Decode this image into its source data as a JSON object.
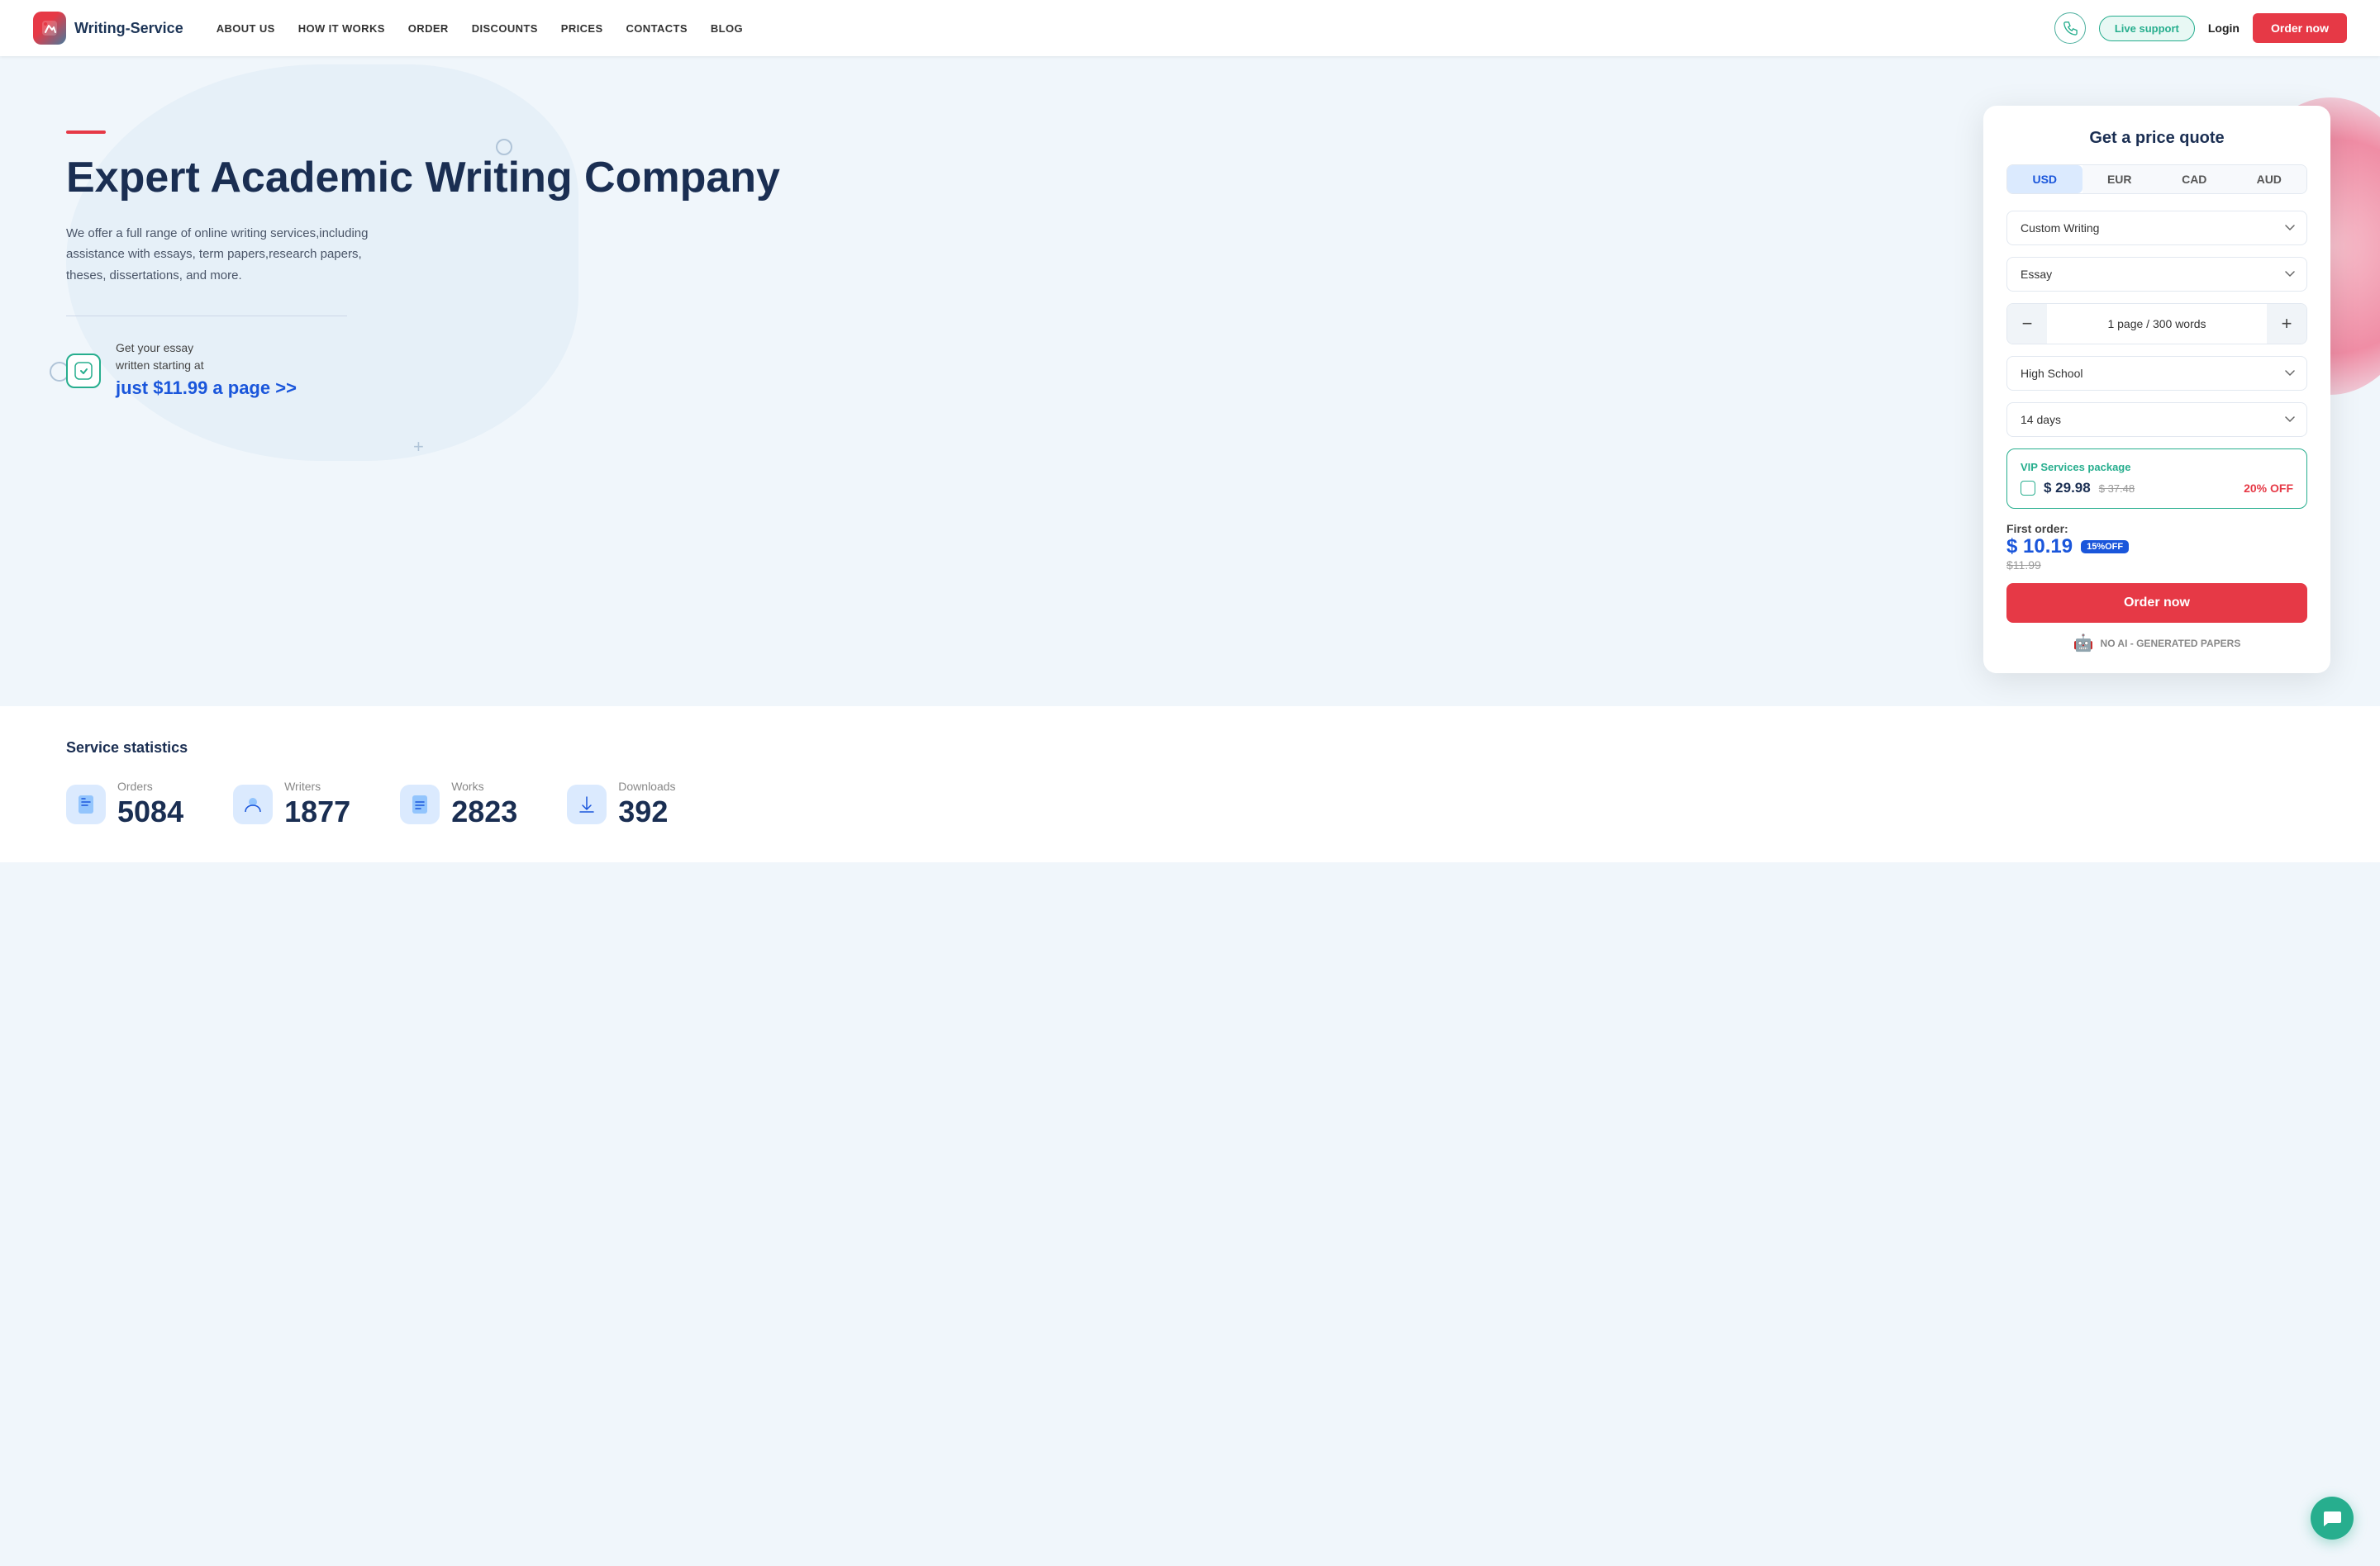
{
  "brand": {
    "logo_text": "Writing-Service",
    "logo_icon": "✏"
  },
  "nav": {
    "links": [
      "ABOUT US",
      "HOW IT WORKS",
      "ORDER",
      "DISCOUNTS",
      "PRICES",
      "CONTACTS",
      "BLOG"
    ],
    "live_support": "Live support",
    "login": "Login",
    "order_now": "Order now"
  },
  "hero": {
    "title": "Expert Academic Writing Company",
    "description": "We offer a full range of online writing services,including assistance with essays, term papers,research papers, theses, dissertations, and more.",
    "cta_text_line1": "Get your essay",
    "cta_text_line2": "written starting at",
    "cta_price": "just $11.99 a page >>"
  },
  "price_quote": {
    "title": "Get a price quote",
    "currencies": [
      "USD",
      "EUR",
      "CAD",
      "AUD"
    ],
    "active_currency": "USD",
    "service_type": "Custom Writing",
    "paper_type": "Essay",
    "pages_label": "1 page / 300 words",
    "academic_level": "High School",
    "deadline": "14 days",
    "vip_title": "VIP Services package",
    "vip_price": "$ 29.98",
    "vip_original": "$ 37.48",
    "vip_discount": "20% OFF",
    "first_order_label": "First order:",
    "first_order_price": "$ 10.19",
    "first_order_badge": "15%OFF",
    "first_order_original": "$11.99",
    "order_now_btn": "Order now",
    "no_ai_text": "NO AI - GENERATED PAPERS"
  },
  "stats": {
    "section_title": "Service statistics",
    "items": [
      {
        "label": "Orders",
        "value": "5084",
        "icon": "📄"
      },
      {
        "label": "Writers",
        "value": "1877",
        "icon": "🔵"
      },
      {
        "label": "Works",
        "value": "2823",
        "icon": "📃"
      },
      {
        "label": "Downloads",
        "value": "392",
        "icon": "⬇"
      }
    ]
  }
}
